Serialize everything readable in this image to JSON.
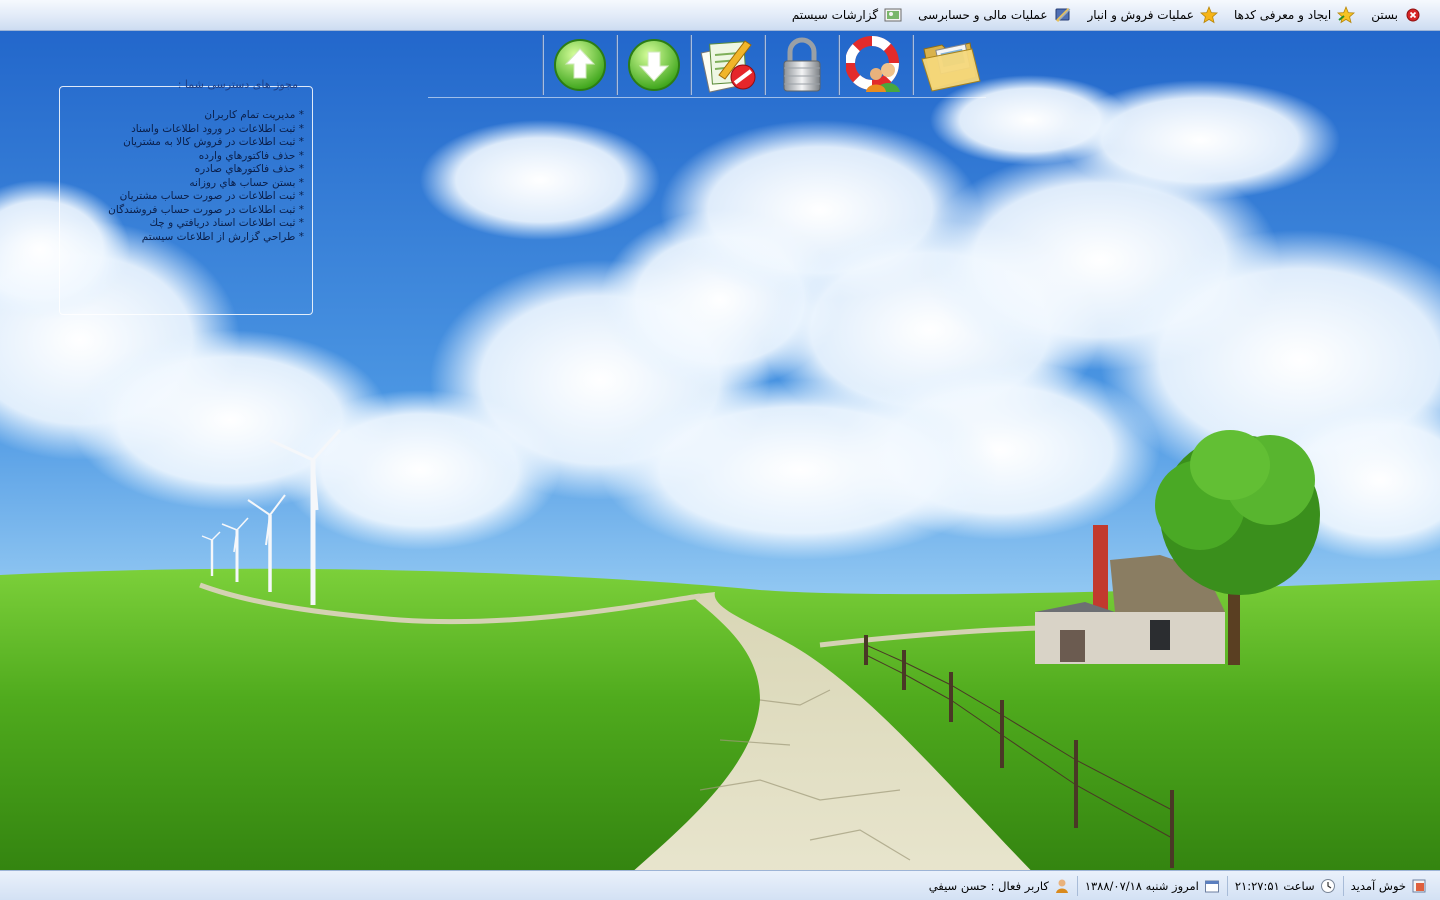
{
  "menu": {
    "items": [
      {
        "label": "بستن",
        "icon": "close-icon"
      },
      {
        "label": "ایجاد و معرفی کدها",
        "icon": "star-icon"
      },
      {
        "label": "عملیات فروش و انبار",
        "icon": "star-icon"
      },
      {
        "label": "عملیات مالی و حسابرسی",
        "icon": "tools-icon"
      },
      {
        "label": "گزارشات سیستم",
        "icon": "report-icon"
      }
    ]
  },
  "toolbar": {
    "buttons": [
      {
        "icon": "folder-icon"
      },
      {
        "icon": "support-users-icon"
      },
      {
        "icon": "lock-icon"
      },
      {
        "icon": "edit-document-icon"
      },
      {
        "icon": "download-arrow-icon"
      },
      {
        "icon": "upload-arrow-icon"
      }
    ]
  },
  "permissions": {
    "title": "مجوز های دسترسی شما :",
    "items": [
      "* مدیریت تمام کاربران",
      "* ثبت اطلاعات در ورود اطلاعات واسناد",
      "* ثبت اطلاعات در فروش کالا به مشتریان",
      "* حذف فاکتورهاي وارده",
      "* حذف فاکتورهاي صادره",
      "* بستن حساب هاي روزانه",
      "* ثبت اطلاعات در صورت حساب مشتریان",
      "* ثبت اطلاعات در صورت حساب فروشندگان",
      "* ثبت اطلاعات اسناد دریافتي و چك",
      "* طراحي گزارش از اطلاعات سیستم"
    ]
  },
  "status": {
    "welcome": "خوش آمدید",
    "time": "ساعت ۲۱:۲۷:۵۱",
    "date": "امروز شنبه ۱۳۸۸/۰۷/۱۸",
    "user": "کاربر فعال : حسن سیفي"
  },
  "colors": {
    "sky_top": "#2a6fd2",
    "grass": "#4fae1c",
    "menubar": "#dfe9f7"
  }
}
